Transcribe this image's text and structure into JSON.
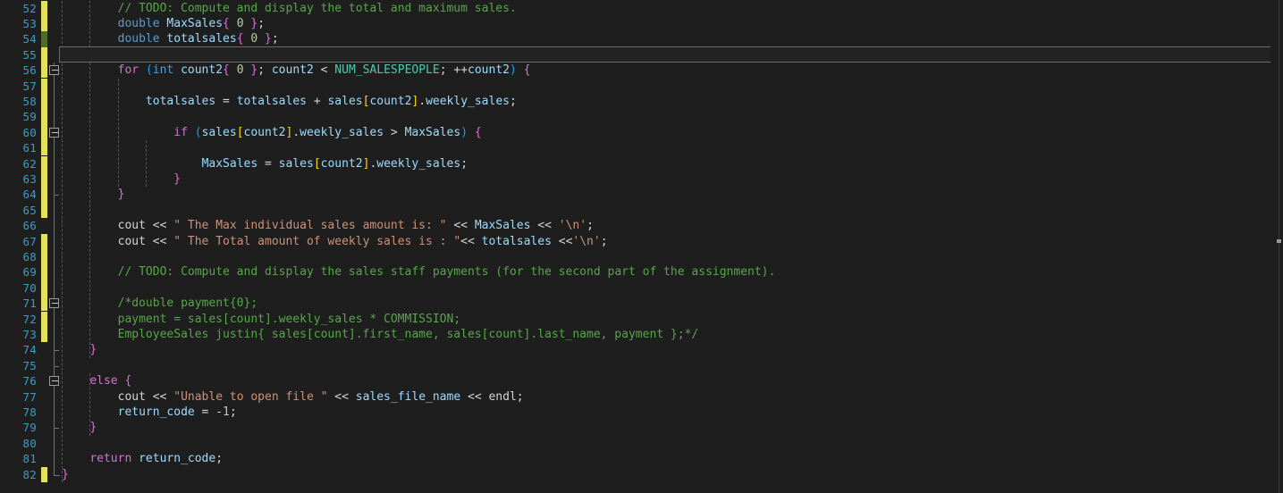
{
  "editor": {
    "language": "cpp",
    "theme": "dark-plus",
    "first_line": 52,
    "last_line": 82,
    "current_line": 55,
    "colors": {
      "background": "#1e1e1e",
      "line_number": "#3d9dc4",
      "comment": "#57a64a",
      "keyword": "#569cd6",
      "control_keyword": "#d670d6",
      "identifier": "#9cdcfe",
      "macro": "#4ec9b0",
      "string": "#ce9178",
      "number": "#b5cea8",
      "plain": "#d4d4d4",
      "change_modified": "#e2e25f",
      "change_added": "#4f6b2a",
      "indent_guide": "#555555",
      "fold_line": "#707070"
    }
  },
  "lines": [
    {
      "n": 52,
      "text": "        // TODO: Compute and display the total and maximum sales."
    },
    {
      "n": 53,
      "text": "        double MaxSales{ 0 };"
    },
    {
      "n": 54,
      "text": "        double totalsales{ 0 };"
    },
    {
      "n": 55,
      "text": ""
    },
    {
      "n": 56,
      "text": "        for (int count2{ 0 }; count2 < NUM_SALESPEOPLE; ++count2) {"
    },
    {
      "n": 57,
      "text": ""
    },
    {
      "n": 58,
      "text": "            totalsales = totalsales + sales[count2].weekly_sales;"
    },
    {
      "n": 59,
      "text": ""
    },
    {
      "n": 60,
      "text": "                if (sales[count2].weekly_sales > MaxSales) {"
    },
    {
      "n": 61,
      "text": ""
    },
    {
      "n": 62,
      "text": "                    MaxSales = sales[count2].weekly_sales;"
    },
    {
      "n": 63,
      "text": "                }"
    },
    {
      "n": 64,
      "text": "        }"
    },
    {
      "n": 65,
      "text": ""
    },
    {
      "n": 66,
      "text": "        cout << \" The Max individual sales amount is: \" << MaxSales << '\\n';"
    },
    {
      "n": 67,
      "text": "        cout << \" The Total amount of weekly sales is : \"<< totalsales <<'\\n';"
    },
    {
      "n": 68,
      "text": ""
    },
    {
      "n": 69,
      "text": "        // TODO: Compute and display the sales staff payments (for the second part of the assignment)."
    },
    {
      "n": 70,
      "text": ""
    },
    {
      "n": 71,
      "text": "        /*double payment{0};"
    },
    {
      "n": 72,
      "text": "        payment = sales[count].weekly_sales * COMMISSION;"
    },
    {
      "n": 73,
      "text": "        EmployeeSales justin{ sales[count].first_name, sales[count].last_name, payment };*/"
    },
    {
      "n": 74,
      "text": "    }"
    },
    {
      "n": 75,
      "text": ""
    },
    {
      "n": 76,
      "text": "    else {"
    },
    {
      "n": 77,
      "text": "        cout << \"Unable to open file \" << sales_file_name << endl;"
    },
    {
      "n": 78,
      "text": "        return_code = -1;"
    },
    {
      "n": 79,
      "text": "    }"
    },
    {
      "n": 80,
      "text": ""
    },
    {
      "n": 81,
      "text": "    return return_code;"
    },
    {
      "n": 82,
      "text": "}"
    }
  ],
  "change_bar": [
    {
      "from": 52,
      "to": 53,
      "kind": "modified"
    },
    {
      "from": 54,
      "to": 54,
      "kind": "added"
    },
    {
      "from": 55,
      "to": 65,
      "kind": "modified"
    },
    {
      "from": 67,
      "to": 67,
      "kind": "modified"
    },
    {
      "from": 68,
      "to": 73,
      "kind": "modified"
    },
    {
      "from": 82,
      "to": 82,
      "kind": "modified"
    }
  ],
  "fold_markers": [
    56,
    60,
    71,
    76
  ],
  "scrollbar": {
    "visible": true,
    "mark_line": 67
  }
}
